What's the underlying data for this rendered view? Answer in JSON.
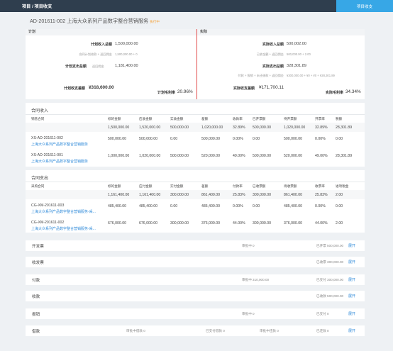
{
  "topbar": {
    "breadcrumb": "项目 / 项目收支",
    "action_button": "项目收支"
  },
  "project": {
    "code_title": "AD-201611-002 上海大众系列产品数字整合营销服务",
    "status": "执行中"
  },
  "summary": {
    "plan": {
      "header": "计划",
      "income_label": "计划收入总额",
      "income_value": "1,500,000.00",
      "income_formula_label": "合同计划收款 + 返回佣金",
      "income_formula_value": "1,500,000.00 + 0",
      "expense_label": "计划支出总额",
      "expense_note": "返回佣金",
      "expense_value": "1,181,400.00",
      "diff_label": "计划收支差额",
      "diff_value": "¥318,600.00",
      "margin_label": "计划毛利率",
      "margin_value": "20.96%"
    },
    "actual": {
      "header": "实际",
      "income_label": "实际收入总额",
      "income_value": "500,002.00",
      "income_formula_label": "已收金额 + 返回佣金",
      "income_formula_value": "500,000.00 + 2.00",
      "expense_label": "实际支出总额",
      "expense_value": "328,301.89",
      "expense_formula_label": "付款 + 报销 + 未还借款 + 返回佣金",
      "expense_formula_value": "¥300,000.00 + ¥0 + ¥0 + ¥28,301.89",
      "diff_label": "实际收支差额",
      "diff_value": "¥171,700.11",
      "margin_label": "实际毛利率",
      "margin_value": "34.34%"
    }
  },
  "contract_income": {
    "title": "合同收入",
    "columns": [
      "销售合同",
      "标的金额",
      "应收金额",
      "实收金额",
      "差额",
      "收款率",
      "已开票额",
      "待开票额",
      "开票率",
      "税额"
    ],
    "total": [
      "1,500,000.00",
      "1,520,000.00",
      "500,000.00",
      "1,020,000.00",
      "32.89%",
      "500,000.00",
      "1,020,000.00",
      "32.89%",
      "28,301.89"
    ],
    "rows": [
      {
        "code": "XS-AD-201611-002",
        "name": "上海大众系列产品数字整合营销服务",
        "cells": [
          "500,000.00",
          "500,000.00",
          "0.00",
          "500,000.00",
          "0.00%",
          "0.00",
          "500,000.00",
          "0.00%",
          "0.00"
        ]
      },
      {
        "code": "XS-AD-201611-001",
        "name": "上海大众系列产品数字整合营销服务",
        "cells": [
          "1,000,000.00",
          "1,020,000.00",
          "500,000.00",
          "520,000.00",
          "49.00%",
          "500,000.00",
          "520,000.00",
          "49.00%",
          "28,301.89"
        ]
      }
    ]
  },
  "contract_expense": {
    "title": "合同支出",
    "columns": [
      "采购合同",
      "标的金额",
      "应付金额",
      "实付金额",
      "差额",
      "付款率",
      "已收票额",
      "待收票额",
      "收票率",
      "进项税金"
    ],
    "total": [
      "1,161,400.00",
      "1,161,400.00",
      "300,000.00",
      "861,400.00",
      "25.83%",
      "300,000.00",
      "861,400.00",
      "25.83%",
      "2.00"
    ],
    "rows": [
      {
        "code": "CG-XM-201611-003",
        "name": "上海大众系列产品数字整合营销服务-采...",
        "cells": [
          "485,400.00",
          "485,400.00",
          "0.00",
          "485,400.00",
          "0.00%",
          "0.00",
          "485,400.00",
          "0.00%",
          "0.00"
        ]
      },
      {
        "code": "CG-XM-201611-002",
        "name": "上海大众系列产品数字整合营销服务-采...",
        "cells": [
          "676,000.00",
          "676,000.00",
          "300,000.00",
          "376,000.00",
          "44.00%",
          "300,000.00",
          "376,000.00",
          "44.00%",
          "2.00"
        ]
      }
    ]
  },
  "sections": [
    {
      "title": "开发票",
      "stats": [
        "审批中 0",
        "已开票 500,000.00"
      ],
      "open": "展开"
    },
    {
      "title": "收发票",
      "stats": [
        "",
        "已收票 300,000.00"
      ],
      "open": "展开"
    },
    {
      "title": "付款",
      "stats": [
        "审批中 310,000.00",
        "已支付 300,000.00"
      ],
      "open": "展开"
    },
    {
      "title": "收款",
      "stats": [
        "",
        "已收款 500,000.00"
      ],
      "open": "展开"
    },
    {
      "title": "报销",
      "stats": [
        "审批中 0",
        "已支付 0"
      ],
      "open": "展开"
    },
    {
      "title": "借款",
      "stats": [
        "审批中借款 0",
        "已支付借款 0",
        "审批中还款 0",
        "已还款 0"
      ],
      "open": "展开"
    }
  ]
}
